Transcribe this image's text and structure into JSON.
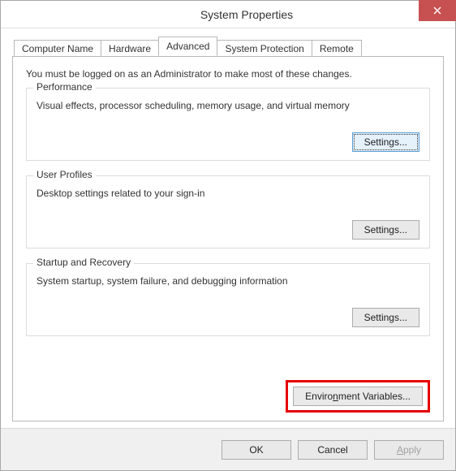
{
  "window": {
    "title": "System Properties"
  },
  "tabs": [
    {
      "label": "Computer Name"
    },
    {
      "label": "Hardware"
    },
    {
      "label": "Advanced"
    },
    {
      "label": "System Protection"
    },
    {
      "label": "Remote"
    }
  ],
  "active_tab_index": 2,
  "advanced": {
    "intro": "You must be logged on as an Administrator to make most of these changes.",
    "performance": {
      "title": "Performance",
      "desc": "Visual effects, processor scheduling, memory usage, and virtual memory",
      "settings_label": "Settings..."
    },
    "user_profiles": {
      "title": "User Profiles",
      "desc": "Desktop settings related to your sign-in",
      "settings_label": "Settings..."
    },
    "startup": {
      "title": "Startup and Recovery",
      "desc": "System startup, system failure, and debugging information",
      "settings_label": "Settings..."
    },
    "env_label_pre": "Enviro",
    "env_label_u": "n",
    "env_label_post": "ment Variables..."
  },
  "footer": {
    "ok": "OK",
    "cancel": "Cancel",
    "apply_pre": "",
    "apply_u": "A",
    "apply_post": "pply"
  }
}
